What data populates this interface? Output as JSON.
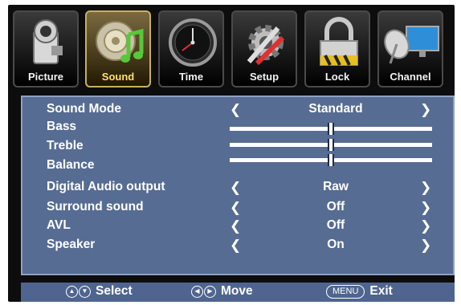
{
  "tabs": [
    {
      "label": "Picture",
      "icon": "camera-icon",
      "active": false
    },
    {
      "label": "Sound",
      "icon": "music-note-icon",
      "active": true
    },
    {
      "label": "Time",
      "icon": "clock-icon",
      "active": false
    },
    {
      "label": "Setup",
      "icon": "tools-gear-icon",
      "active": false
    },
    {
      "label": "Lock",
      "icon": "padlock-icon",
      "active": false
    },
    {
      "label": "Channel",
      "icon": "satellite-dish-icon",
      "active": false
    }
  ],
  "settings": {
    "sound_mode": {
      "label": "Sound Mode",
      "value": "Standard"
    },
    "bass": {
      "label": "Bass",
      "level": 0.5
    },
    "treble": {
      "label": "Treble",
      "level": 0.5
    },
    "balance": {
      "label": "Balance",
      "level": 0.5
    },
    "digital_audio": {
      "label": "Digital Audio output",
      "value": "Raw"
    },
    "surround": {
      "label": "Surround sound",
      "value": "Off"
    },
    "avl": {
      "label": "AVL",
      "value": "Off"
    },
    "speaker": {
      "label": "Speaker",
      "value": "On"
    }
  },
  "footer": {
    "select": "Select",
    "move": "Move",
    "menu_key": "MENU",
    "exit": "Exit"
  },
  "colors": {
    "panel": "#566c93",
    "active_tab": "#c8b060",
    "background": "#0d0d0d"
  }
}
